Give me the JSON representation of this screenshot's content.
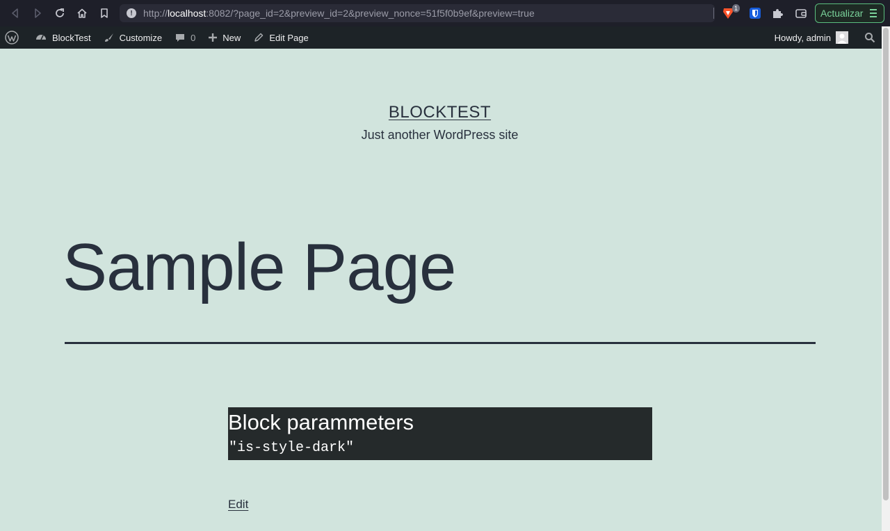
{
  "browser": {
    "url_prefix": "http://",
    "url_host": "localhost",
    "url_rest": ":8082/?page_id=2&preview_id=2&preview_nonce=51f5f0b9ef&preview=true",
    "brave_badge": "1",
    "update_label": "Actualizar"
  },
  "admin_bar": {
    "site_name": "BlockTest",
    "customize": "Customize",
    "comments_count": "0",
    "new": "New",
    "edit_page": "Edit Page",
    "howdy": "Howdy, admin"
  },
  "site": {
    "title": "BLOCKTEST",
    "description": "Just another WordPress site"
  },
  "page": {
    "heading": "Sample Page",
    "block_title": "Block parammeters",
    "block_code": "\"is-style-dark\"",
    "edit_link": "Edit"
  },
  "colors": {
    "page_background": "#d1e4dd",
    "text": "#28303d",
    "admin_bar": "#1d2327",
    "block_background": "#252a2b",
    "update_accent": "#5bbf7e"
  }
}
